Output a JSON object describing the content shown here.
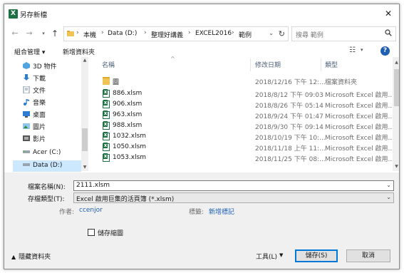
{
  "window": {
    "title": "另存新檔",
    "app_icon": "excel-icon",
    "close_glyph": "✕"
  },
  "address": {
    "crumbs": [
      "本機",
      "Data (D:)",
      "整理好講義",
      "EXCEL2016",
      "範例"
    ],
    "search_placeholder": "搜尋 範例"
  },
  "toolbar": {
    "organize": "組合管理 ▾",
    "new_folder": "新增資料夾"
  },
  "nav": {
    "items": [
      {
        "label": "3D 物件",
        "icon": "3d-objects-icon"
      },
      {
        "label": "下載",
        "icon": "downloads-icon"
      },
      {
        "label": "文件",
        "icon": "documents-icon"
      },
      {
        "label": "音樂",
        "icon": "music-icon"
      },
      {
        "label": "桌面",
        "icon": "desktop-icon"
      },
      {
        "label": "圖片",
        "icon": "pictures-icon"
      },
      {
        "label": "影片",
        "icon": "videos-icon"
      },
      {
        "label": "Acer (C:)",
        "icon": "drive-icon"
      },
      {
        "label": "Data (D:)",
        "icon": "drive-icon",
        "selected": true
      }
    ]
  },
  "columns": {
    "name": "名稱",
    "modified": "修改日期",
    "type": "類型"
  },
  "files": [
    {
      "name": "圖",
      "date": "2018/12/16 下午 12:...",
      "type": "檔案資料夾",
      "icon": "folder-icon"
    },
    {
      "name": "886.xlsm",
      "date": "2018/8/12 下午 09:03",
      "type": "Microsoft Excel 啟用...",
      "icon": "excel-file-icon"
    },
    {
      "name": "906.xlsm",
      "date": "2018/8/26 下午 05:14",
      "type": "Microsoft Excel 啟用...",
      "icon": "excel-file-icon"
    },
    {
      "name": "963.xlsm",
      "date": "2018/9/24 下午 01:47",
      "type": "Microsoft Excel 啟用...",
      "icon": "excel-file-icon"
    },
    {
      "name": "988.xlsm",
      "date": "2018/9/30 下午 09:14",
      "type": "Microsoft Excel 啟用...",
      "icon": "excel-file-icon"
    },
    {
      "name": "1032.xlsm",
      "date": "2018/10/19 下午 10:...",
      "type": "Microsoft Excel 啟用...",
      "icon": "excel-file-icon"
    },
    {
      "name": "1050.xlsm",
      "date": "2018/11/18 上午 11:...",
      "type": "Microsoft Excel 啟用...",
      "icon": "excel-file-icon"
    },
    {
      "name": "1053.xlsm",
      "date": "2018/11/25 下午 08:...",
      "type": "Microsoft Excel 啟用...",
      "icon": "excel-file-icon"
    }
  ],
  "form": {
    "filename_label": "檔案名稱(N):",
    "filename_value": "2111.xlsm",
    "filetype_label": "存檔類型(T):",
    "filetype_value": "Excel 啟用巨集的活頁簿 (*.xlsm)",
    "author_label": "作者:",
    "author_value": "ccenjor",
    "tags_label": "標籤:",
    "tags_value": "新增標記",
    "thumbnail_label": "儲存縮圖",
    "hide_folders": "隱藏資料夾",
    "tools": "工具(L)",
    "save": "儲存(S)",
    "cancel": "取消"
  },
  "colors": {
    "accent": "#0078d7",
    "selection": "#cce8ff",
    "excel_green": "#1e7145",
    "link": "#1e5fb3"
  }
}
